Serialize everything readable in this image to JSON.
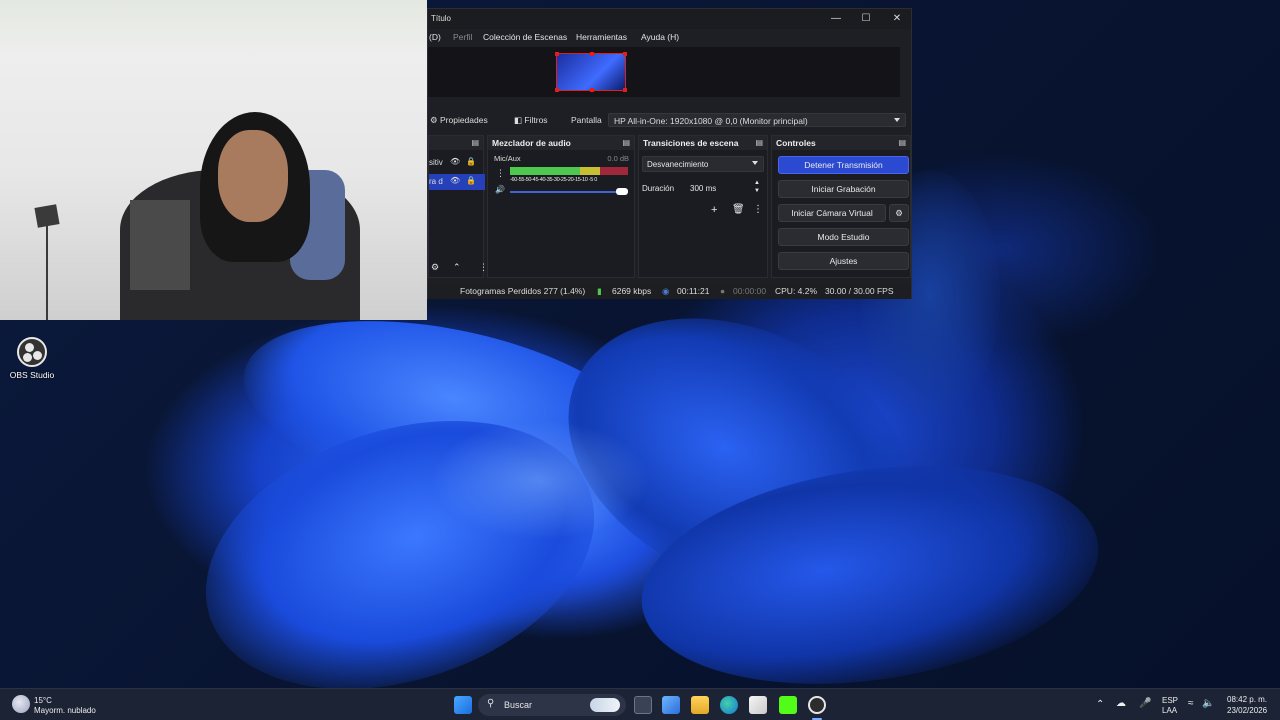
{
  "obs": {
    "title": "Título",
    "menu": {
      "partial_menu": "(D)",
      "profile": "Perfil",
      "scene_collection": "Colección de Escenas",
      "tools": "Herramientas",
      "help": "Ayuda (H)"
    },
    "source_toolbar": {
      "properties": "Propiedades",
      "filters": "Filtros",
      "display_label": "Pantalla",
      "display_value": "HP All-in-One: 1920x1080 @ 0,0 (Monitor principal)"
    },
    "sources": {
      "items": [
        {
          "label": "sitiv"
        },
        {
          "label": "ra d"
        }
      ]
    },
    "audio_mixer": {
      "title": "Mezclador de audio",
      "channel": "Mic/Aux",
      "level": "0.0 dB",
      "scale": "-60-55-50-45-40-35-30-25-20-15-10 -5  0"
    },
    "transitions": {
      "title": "Transiciones de escena",
      "selected": "Desvanecimiento",
      "duration_label": "Duración",
      "duration_value": "300 ms"
    },
    "controls": {
      "title": "Controles",
      "stop_stream": "Detener Transmisión",
      "start_recording": "Iniciar Grabación",
      "virtual_camera": "Iniciar Cámara Virtual",
      "studio_mode": "Modo Estudio",
      "settings": "Ajustes"
    },
    "status": {
      "dropped_frames": "Fotogramas Perdidos 277 (1.4%)",
      "bitrate": "6269 kbps",
      "stream_time": "00:11:21",
      "record_time": "00:00:00",
      "cpu": "CPU: 4.2%",
      "fps": "30.00 / 30.00 FPS"
    },
    "colors": {
      "accent": "#2c4ad1",
      "bg": "#1e1f24",
      "selection": "#e02020"
    }
  },
  "desktop": {
    "icon_label": "OBS Studio",
    "icon_name": "obs-studio-icon"
  },
  "taskbar": {
    "weather_temp": "15°C",
    "weather_desc": "Mayorm. nublado",
    "search_placeholder": "Buscar",
    "lang_top": "ESP",
    "lang_bottom": "LAA",
    "time": "08:42 p. m.",
    "date": "23/02/2026",
    "apps": [
      "windows-start-icon",
      "search-icon",
      "task-view-icon",
      "widgets-icon",
      "file-explorer-icon",
      "edge-icon",
      "store-icon",
      "kick-icon",
      "obs-icon"
    ]
  }
}
